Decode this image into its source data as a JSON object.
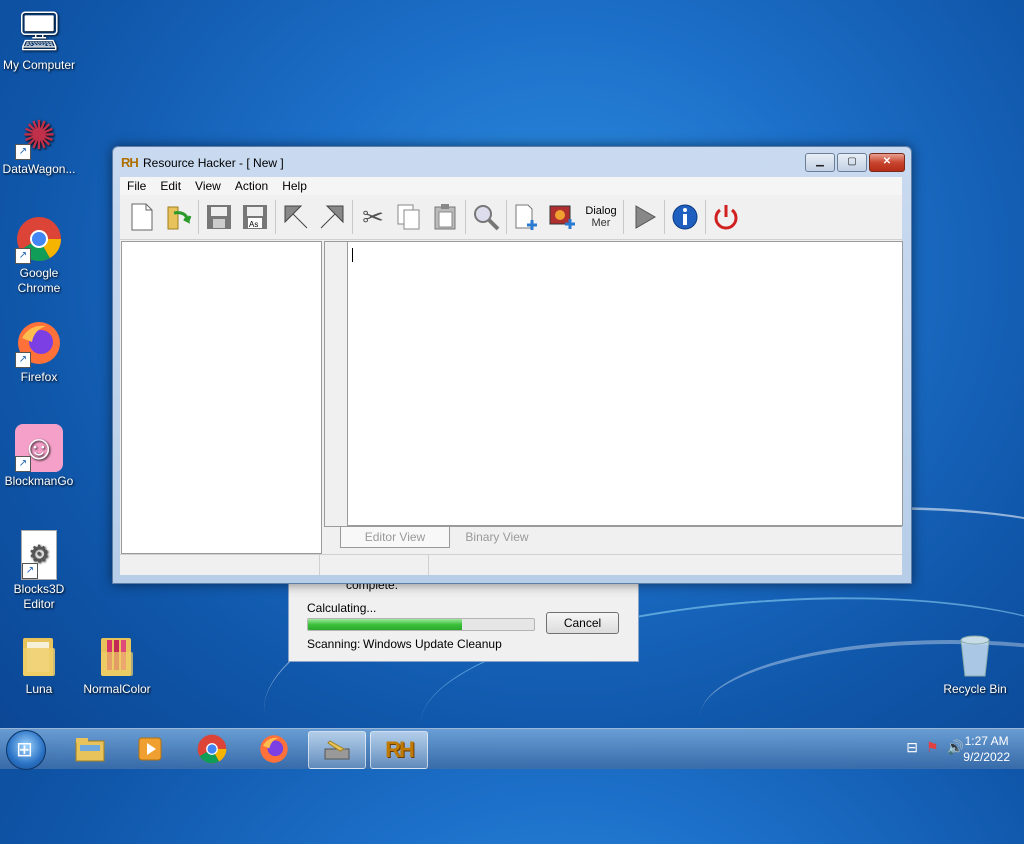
{
  "desktop": {
    "icons": [
      {
        "label": "My Computer",
        "glyph": "🖥"
      },
      {
        "label": "DataWagon...",
        "glyph": "✺"
      },
      {
        "label": "Google Chrome",
        "glyph": "◉"
      },
      {
        "label": "Firefox",
        "glyph": "🦊"
      },
      {
        "label": "BlockmanGo",
        "glyph": "☺"
      },
      {
        "label": "Blocks3D Editor",
        "glyph": "⚙"
      },
      {
        "label": "Luna",
        "glyph": "📁"
      },
      {
        "label": "NormalColor",
        "glyph": "📁"
      },
      {
        "label": "Recycle Bin",
        "glyph": "🗑"
      }
    ]
  },
  "bg_dialog": {
    "partial_text": "complete.",
    "status": "Calculating...",
    "progress_percent": 68,
    "scanning_label": "Scanning:",
    "scanning_item": "Windows Update Cleanup",
    "cancel_label": "Cancel"
  },
  "window": {
    "app_icon_text": "RH",
    "title": "Resource Hacker - [ New ]",
    "menu": [
      "File",
      "Edit",
      "View",
      "Action",
      "Help"
    ],
    "dialog_menu_label_1": "Dialog",
    "dialog_menu_label_2": "Mer",
    "tabs": {
      "editor": "Editor View",
      "binary": "Binary View"
    }
  },
  "taskbar": {
    "time": "1:27 AM",
    "date": "9/2/2022",
    "rh_label": "RH"
  },
  "icons": {
    "new": "new-file-icon",
    "open": "open-folder-icon",
    "save": "save-icon",
    "save_as": "save-as-icon",
    "back": "back-arrow-icon",
    "forward": "forward-arrow-icon",
    "cut": "scissors-icon",
    "copy": "copy-icon",
    "paste": "paste-icon",
    "find": "magnifier-icon",
    "add_resource": "add-resource-icon",
    "add_image": "add-image-icon",
    "dialog_menu": "dialog-menu-icon",
    "run": "play-icon",
    "info": "info-icon",
    "power": "power-icon"
  }
}
